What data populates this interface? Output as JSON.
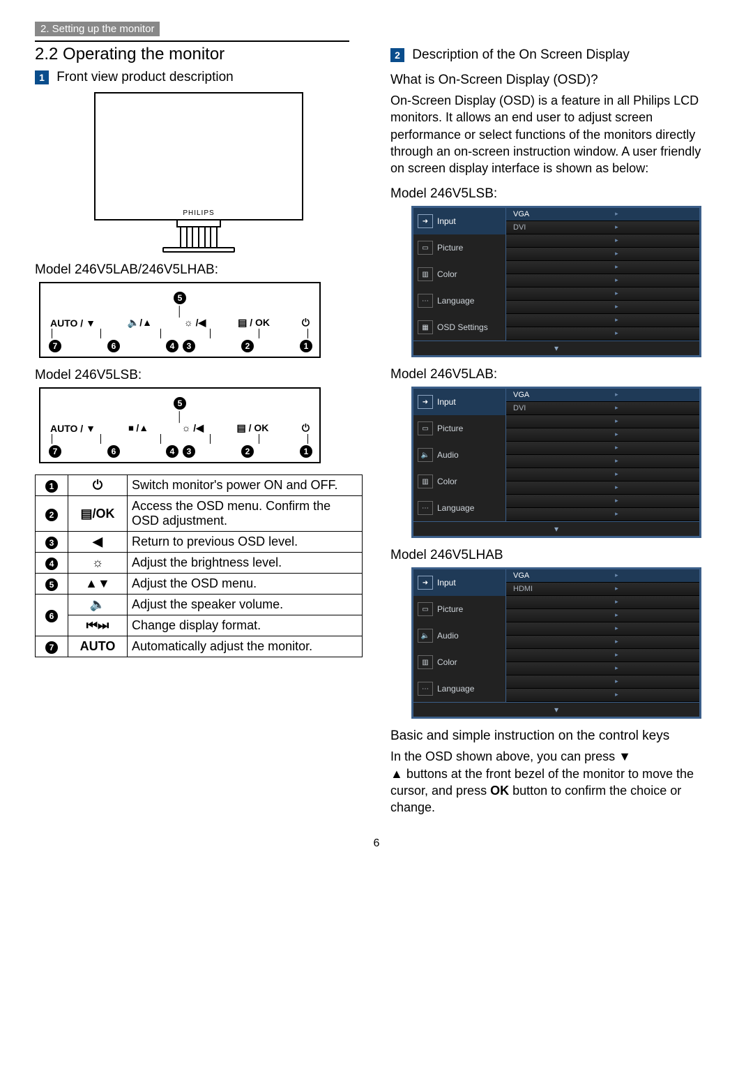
{
  "breadcrumb": "2. Setting up the monitor",
  "section_title": "2.2  Operating the monitor",
  "sub1_num": "1",
  "sub1_title": "Front view product description",
  "monitor_brand": "PHILIPS",
  "panel_model_a": "Model 246V5LAB/246V5LHAB:",
  "panel_model_b": "Model 246V5LSB:",
  "panelA": {
    "btn_auto": "AUTO / ▼",
    "btn_vol": "🔈/▲",
    "btn_bright": "☼ /◀",
    "btn_menu": "▤ / OK",
    "btn_power": "⏻"
  },
  "panelB": {
    "btn_auto": "AUTO / ▼",
    "btn_fmt": "⏹ /▲",
    "btn_bright": "☼ /◀",
    "btn_menu": "▤ / OK",
    "btn_power": "⏻"
  },
  "table": {
    "r1_icon": "⏻",
    "r1_desc": "Switch monitor's power ON and OFF.",
    "r2_icon": "▤/OK",
    "r2_desc": "Access the OSD menu. Confirm the OSD adjustment.",
    "r3_icon": "◀",
    "r3_desc": "Return to previous OSD level.",
    "r4_icon": "☼",
    "r4_desc": "Adjust the brightness level.",
    "r5_icon": "▲▼",
    "r5_desc": "Adjust the OSD menu.",
    "r6a_icon": "🔈",
    "r6a_desc": "Adjust the speaker volume.",
    "r6b_icon": "⏮⏭",
    "r6b_desc": "Change display format.",
    "r7_icon": "AUTO",
    "r7_desc": "Automatically adjust the monitor."
  },
  "sub2_num": "2",
  "sub2_title": "Description of the On Screen Display",
  "q_title": "What is On-Screen Display (OSD)?",
  "q_body": "On-Screen Display (OSD) is a feature in all Philips LCD monitors. It allows an end user to adjust screen performance or select functions of the monitors directly through an on-screen instruction window. A user friendly on screen display interface is shown as below:",
  "osd1_title": "Model 246V5LSB:",
  "osd1": {
    "items": [
      "Input",
      "Picture",
      "Color",
      "Language",
      "OSD Settings"
    ],
    "opts": [
      "VGA",
      "DVI"
    ]
  },
  "osd2_title": "Model 246V5LAB:",
  "osd2": {
    "items": [
      "Input",
      "Picture",
      "Audio",
      "Color",
      "Language"
    ],
    "opts": [
      "VGA",
      "DVI"
    ]
  },
  "osd3_title": "Model 246V5LHAB",
  "osd3": {
    "items": [
      "Input",
      "Picture",
      "Audio",
      "Color",
      "Language"
    ],
    "opts": [
      "VGA",
      "HDMI"
    ]
  },
  "instr_title": "Basic and simple instruction on the control keys",
  "instr_body_a": "In the OSD shown above, you can press ▼",
  "instr_body_b": "▲ buttons at the front bezel of the monitor to move the cursor, and press ",
  "instr_body_ok": "OK",
  "instr_body_c": " button to confirm the choice or change.",
  "page_number": "6",
  "circles": [
    "1",
    "2",
    "3",
    "4",
    "5",
    "6",
    "7"
  ],
  "panel_top_circle": "5",
  "panel_order_bottom": [
    "7",
    "6",
    "4",
    "3",
    "2",
    "1"
  ]
}
